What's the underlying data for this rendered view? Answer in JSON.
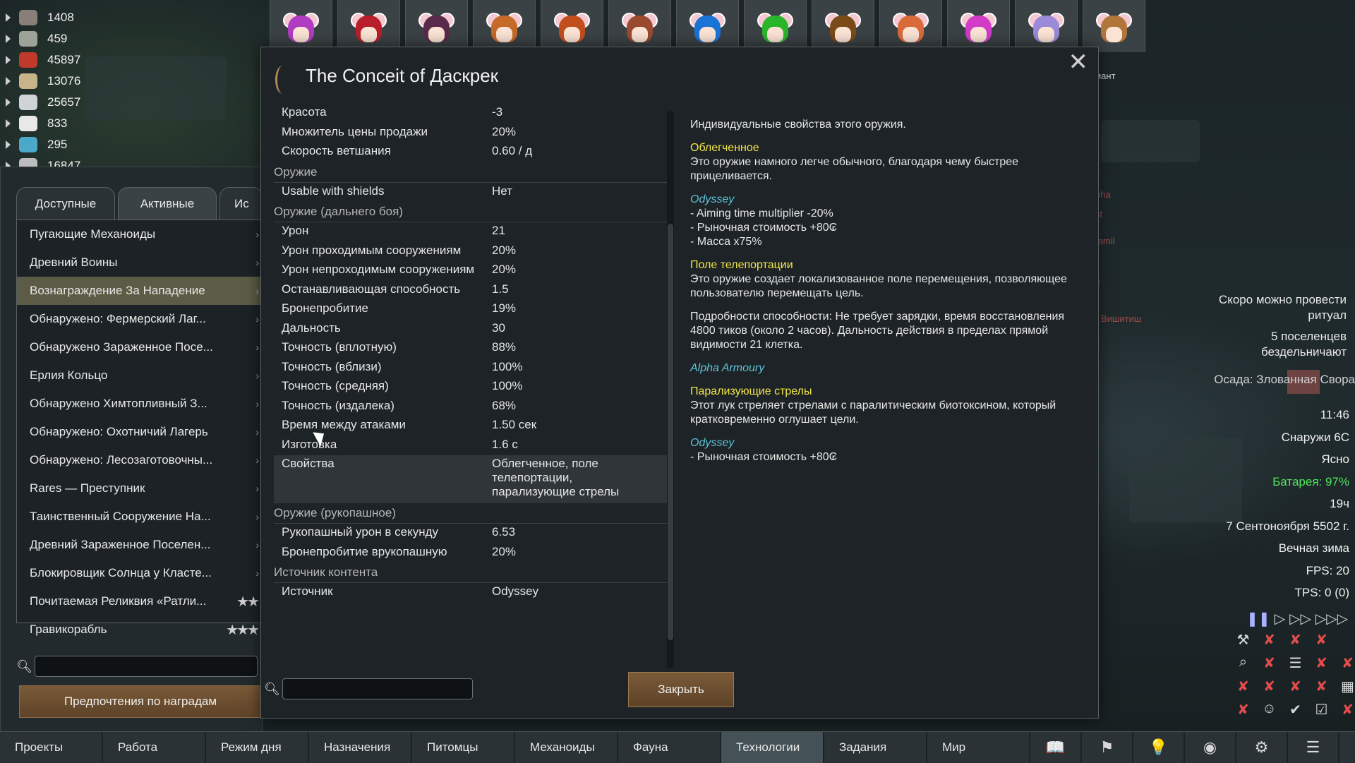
{
  "resources": [
    {
      "value": "1408",
      "icon": "rock-chunks-icon",
      "color": "#8a7f78"
    },
    {
      "value": "459",
      "icon": "silver-icon",
      "color": "#9ea39a"
    },
    {
      "value": "45897",
      "icon": "berries-icon",
      "color": "#c0392b"
    },
    {
      "value": "13076",
      "icon": "wood-icon",
      "color": "#c9b489"
    },
    {
      "value": "25657",
      "icon": "steel-icon",
      "color": "#d0d3d6"
    },
    {
      "value": "833",
      "icon": "medicine-icon",
      "color": "#e8e8e8"
    },
    {
      "value": "295",
      "icon": "pill-icon",
      "color": "#4ba8c9"
    },
    {
      "value": "16847",
      "icon": "cloth-icon",
      "color": "#bdbdbd"
    }
  ],
  "colonists": [
    {
      "hair": "#b13cc1"
    },
    {
      "hair": "#b81f2a"
    },
    {
      "hair": "#5a2a4a"
    },
    {
      "hair": "#c56a28"
    },
    {
      "hair": "#c24e1e"
    },
    {
      "hair": "#9a4a2e"
    },
    {
      "hair": "#1a74d8"
    },
    {
      "hair": "#2bb52b"
    },
    {
      "hair": "#7a4a18"
    },
    {
      "hair": "#d96a3a"
    },
    {
      "hair": "#d23cc7"
    },
    {
      "hair": "#9a8ad8"
    },
    {
      "hair": "#b0763a"
    }
  ],
  "colonist_name_fragment": "омант",
  "quests": {
    "tabs": [
      "Доступные",
      "Активные",
      "Ис"
    ],
    "items": [
      {
        "label": "Пугающие Механоиды",
        "stars": ""
      },
      {
        "label": "Древний Воины",
        "stars": ""
      },
      {
        "label": "Вознаграждение За Нападение",
        "stars": "",
        "selected": true
      },
      {
        "label": "Обнаружено: Фермерский Лаг...",
        "stars": ""
      },
      {
        "label": "Обнаружено Зараженное Посе...",
        "stars": ""
      },
      {
        "label": "Ерлия Кольцо",
        "stars": ""
      },
      {
        "label": "Обнаружено Химтопливный З...",
        "stars": ""
      },
      {
        "label": "Обнаружено: Охотничий Лагерь",
        "stars": ""
      },
      {
        "label": "Обнаружено: Лесозаготовочны...",
        "stars": ""
      },
      {
        "label": "Rares — Преступник",
        "stars": ""
      },
      {
        "label": "Таинственный Сооружение На...",
        "stars": ""
      },
      {
        "label": "Древний Зараженное Поселен...",
        "stars": ""
      },
      {
        "label": "Блокировщик Солнца у Класте...",
        "stars": ""
      },
      {
        "label": "Почитаемая Реликвия «Ратли...",
        "stars": "★★"
      },
      {
        "label": "Гравикорабль",
        "stars": "★★★"
      }
    ],
    "reward_button": "Предпочтения по наградам"
  },
  "dialog": {
    "title": "The Conceit of Даскрек",
    "rows": [
      {
        "type": "stat",
        "k": "Красота",
        "v": "-3"
      },
      {
        "type": "stat",
        "k": "Множитель цены продажи",
        "v": "20%"
      },
      {
        "type": "stat",
        "k": "Скорость ветшания",
        "v": "0.60 / д"
      },
      {
        "type": "cat",
        "k": "Оружие"
      },
      {
        "type": "stat",
        "k": "Usable with shields",
        "v": "Нет"
      },
      {
        "type": "cat",
        "k": "Оружие (дальнего боя)"
      },
      {
        "type": "stat",
        "k": "Урон",
        "v": "21"
      },
      {
        "type": "stat",
        "k": "Урон проходимым сооружениям",
        "v": "20%"
      },
      {
        "type": "stat",
        "k": "Урон непроходимым сооружениям",
        "v": "20%"
      },
      {
        "type": "stat",
        "k": "Останавливающая способность",
        "v": "1.5"
      },
      {
        "type": "stat",
        "k": "Бронепробитие",
        "v": "19%"
      },
      {
        "type": "stat",
        "k": "Дальность",
        "v": "30"
      },
      {
        "type": "stat",
        "k": "Точность (вплотную)",
        "v": "88%"
      },
      {
        "type": "stat",
        "k": "Точность (вблизи)",
        "v": "100%"
      },
      {
        "type": "stat",
        "k": "Точность (средняя)",
        "v": "100%"
      },
      {
        "type": "stat",
        "k": "Точность (издалека)",
        "v": "68%"
      },
      {
        "type": "stat",
        "k": "Время между атаками",
        "v": "1.50 сек"
      },
      {
        "type": "stat",
        "k": "Изготовка",
        "v": "1.6 с"
      },
      {
        "type": "stat",
        "k": "Свойства",
        "v": "Облегченное, поле телепортации, парализующие стрелы",
        "hl": true
      },
      {
        "type": "cat",
        "k": "Оружие (рукопашное)"
      },
      {
        "type": "stat",
        "k": "Рукопашный урон в секунду",
        "v": "6.53"
      },
      {
        "type": "stat",
        "k": "Бронепробитие врукопашную",
        "v": "20%"
      },
      {
        "type": "cat",
        "k": "Источник контента"
      },
      {
        "type": "stat",
        "k": "Источник",
        "v": "Odyssey"
      }
    ],
    "desc_intro": "Индивидуальные свойства этого оружия.",
    "traits": [
      {
        "name": "Облегченное",
        "text": "Это оружие намного легче обычного, благодаря чему быстрее прицеливается."
      },
      {
        "source": "Odyssey",
        "text": " - Aiming time multiplier -20%\n - Рыночная стоимость +80₢\n - Масса x75%"
      },
      {
        "name": "Поле телепортации",
        "text": "Это оружие создает локализованное поле перемещения, позволяющее пользователю перемещать цель."
      },
      {
        "text": "Подробности способности: Не требует зарядки, время восстановления 4800 тиков (около 2 часов). Дальность действия в пределах прямой видимости 21 клетка."
      },
      {
        "source": "Alpha Armoury"
      },
      {
        "name": "Парализующие стрелы",
        "text": "Этот лук стреляет стрелами с паралитическим биотоксином, который кратковременно оглушает цели."
      },
      {
        "source": "Odyssey",
        "text": " - Рыночная стоимость +80₢"
      }
    ],
    "close_label": "Закрыть"
  },
  "right_panel": {
    "alerts": [
      "Скоро можно провести ритуал",
      "5 поселенцев бездельничают"
    ],
    "siege": "Осада: Злованная Свора",
    "status": [
      {
        "text": "11:46"
      },
      {
        "text": "Снаружи 6C"
      },
      {
        "text": "Ясно"
      },
      {
        "text": "Батарея: 97%",
        "color": "#4ee65a"
      },
      {
        "text": "19ч"
      },
      {
        "text": "7 Сентоноября 5502 г."
      },
      {
        "text": "Вечная зима"
      },
      {
        "text": "FPS: 20"
      },
      {
        "text": "TPS: 0 (0)"
      }
    ],
    "map_labels": [
      "oha",
      "st",
      "Vamil",
      "ti",
      "Вишитиш"
    ]
  },
  "bottom_tabs": [
    "Проекты",
    "Работа",
    "Режим дня",
    "Назначения",
    "Питомцы",
    "Механоиды",
    "Фауна",
    "Технологии",
    "Задания",
    "Мир"
  ],
  "bottom_active": "Технологии",
  "bottom_icons": [
    "book-icon",
    "factions-icon",
    "lightbulb-icon",
    "ideology-icon",
    "inspect-icon",
    "menu-icon"
  ]
}
